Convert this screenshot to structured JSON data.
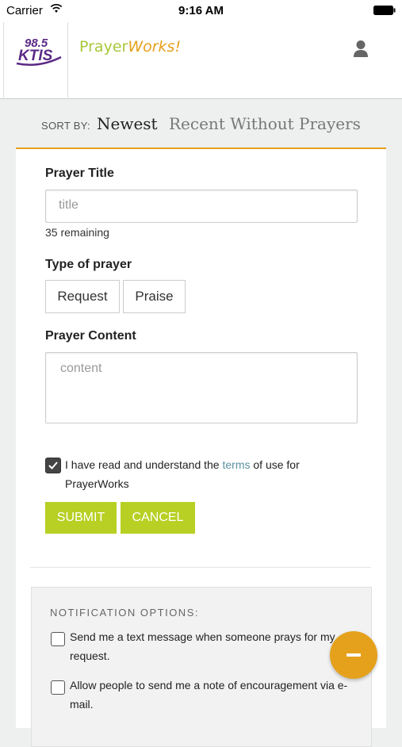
{
  "status_bar": {
    "carrier": "Carrier",
    "time": "9:16 AM"
  },
  "header": {
    "station_logo": {
      "number": "98.5",
      "letters": "KTIS"
    },
    "brand_part1": "Prayer",
    "brand_part2": "Works!",
    "user_icon": "user-icon"
  },
  "sort": {
    "label": "SORT BY:",
    "options": [
      "Newest",
      "Recent Without Prayers"
    ],
    "selected": "Newest"
  },
  "form": {
    "title_label": "Prayer Title",
    "title_placeholder": "title",
    "remaining": "35 remaining",
    "type_label": "Type of prayer",
    "types": [
      "Request",
      "Praise"
    ],
    "content_label": "Prayer Content",
    "content_placeholder": "content",
    "terms_before": "I have read and understand the ",
    "terms_link": "terms",
    "terms_after": " of use for PrayerWorks",
    "submit": "SUBMIT",
    "cancel": "CANCEL"
  },
  "notifications": {
    "title": "NOTIFICATION OPTIONS:",
    "options": [
      "Send me a text message when someone prays for my request.",
      "Allow people to send me a note of encouragement via e-mail."
    ]
  },
  "colors": {
    "accent": "#e5a11b",
    "button": "#b7d023",
    "link": "#5a8fa0"
  }
}
